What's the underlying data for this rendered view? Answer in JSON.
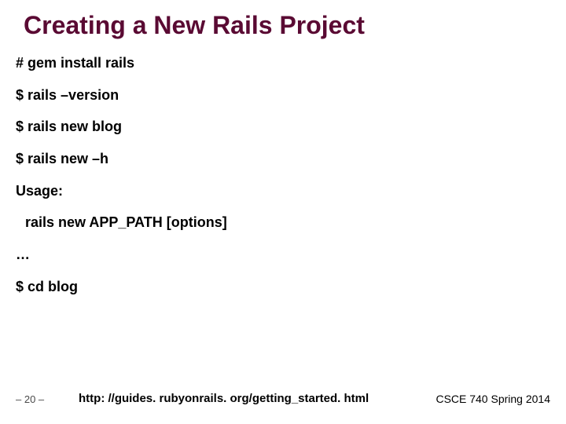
{
  "title": "Creating a New Rails Project",
  "lines": {
    "l1": "# gem install rails",
    "l2": "$ rails –version",
    "l3": "$ rails new blog",
    "l4": "$ rails new –h",
    "l5": "Usage:",
    "l6": "rails new APP_PATH [options]",
    "l7": "…",
    "l8": "$ cd blog"
  },
  "footer": {
    "left": "– 20 –",
    "center": "http: //guides. rubyonrails. org/getting_started. html",
    "right": "CSCE 740 Spring 2014"
  }
}
